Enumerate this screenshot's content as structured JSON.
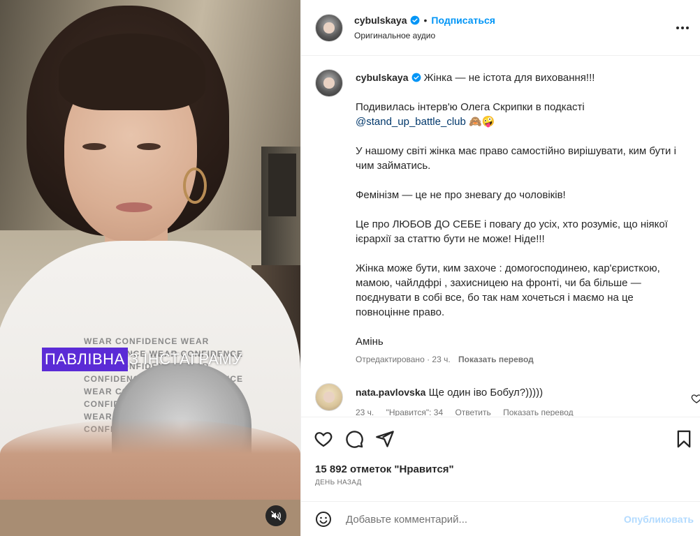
{
  "post": {
    "username": "cybulskaya",
    "follow_label": "Подписаться",
    "separator": "•",
    "audio_label": "Оригинальное аудио"
  },
  "video": {
    "subtitle_highlight": "ПАВЛІВНА",
    "subtitle_rest": "З ІНСТАГРАМУ",
    "shirt_print": "WEAR CONFIDENCE WEAR CONFIDENCE WEAR CONFIDENCE WEAR CONFIDENCE WEAR CONFIDENCE WEAR CONFIDENCE WEAR CONFIDENCE WEAR CONFIDENCE WEAR CONFIDENCE WEAR CONFIDENCE WEAR CONFIDENCE WEAR CONFIDENCE"
  },
  "caption": {
    "first_line": "Жінка — не істота для виховання!!!",
    "p2_text": "Подивилась інтерв'ю Олега Скрипки в подкасті",
    "p2_mention": "@stand_up_battle_club",
    "p2_emoji": "🙈🤪",
    "p3": "У нашому світі жінка має право самостійно вирішувати, ким бути і чим займатись.",
    "p4": "Фемінізм — це не про зневагу до чоловіків!",
    "p5": "Це про ЛЮБОВ ДО СЕБЕ і повагу до усіх, хто розуміє, що ніякої ієрархії за статтю бути не може! Ніде!!!",
    "p6": "Жінка може бути, ким захоче : домогосподинею, кар'єристкою, мамою, чайлдфрі , захисницею на фронті, чи ба більше — поєднувати в собі все, бо так нам хочеться і маємо на це повноцінне право.",
    "p7": "Амінь",
    "edited": "Отредактировано · 23 ч.",
    "translate": "Показать перевод"
  },
  "comment": {
    "username": "nata.pavlovska",
    "text": "Ще один іво Бобул?)))))",
    "time": "23 ч.",
    "likes": "\"Нравится\": 34",
    "reply": "Ответить",
    "translate": "Показать перевод"
  },
  "stats": {
    "likes": "15 892 отметок \"Нравится\"",
    "date": "ДЕНЬ НАЗАД"
  },
  "composer": {
    "placeholder": "Добавьте комментарий...",
    "publish": "Опубликовать"
  },
  "colors": {
    "accent": "#0095f6",
    "subtitle_highlight": "#5b2bd6",
    "publish_disabled": "#b3dbff"
  }
}
